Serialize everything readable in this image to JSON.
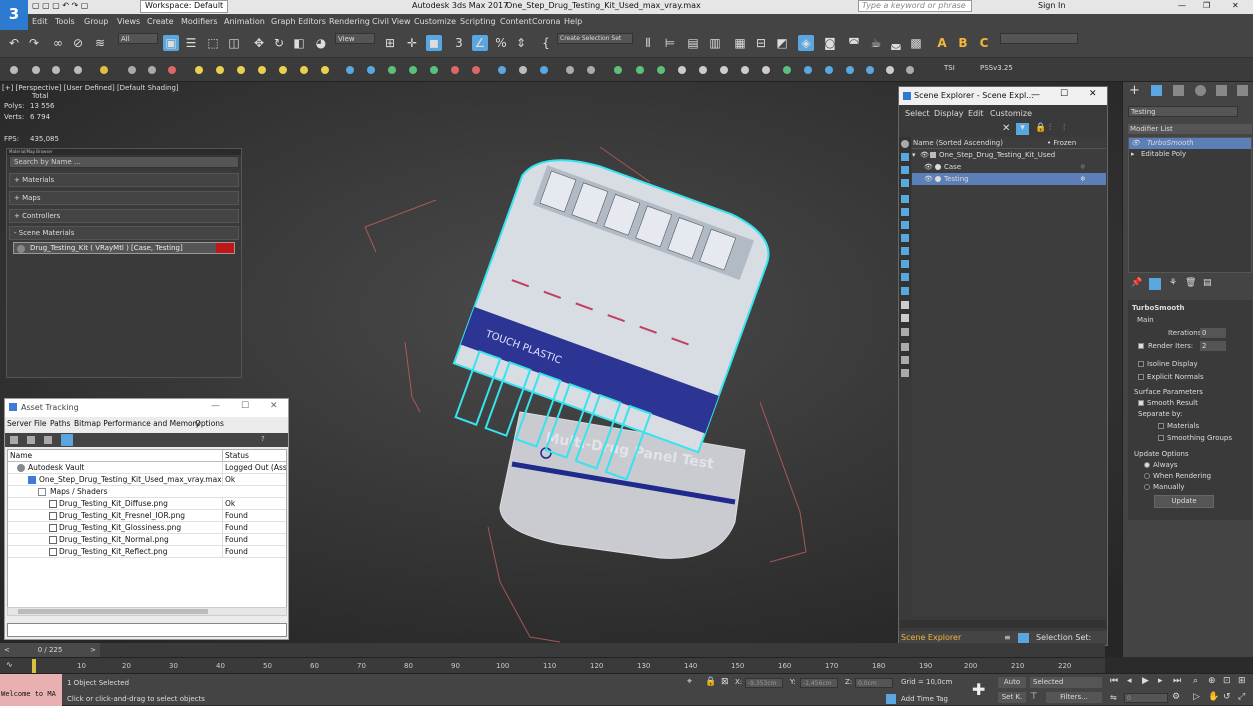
{
  "titlebar": {
    "workspace": "Workspace: Default",
    "app_title": "Autodesk 3ds Max 2017",
    "file_title": "One_Step_Drug_Testing_Kit_Used_max_vray.max",
    "search_placeholder": "Type a keyword or phrase",
    "sign_in": "Sign In"
  },
  "menu": [
    "Edit",
    "Tools",
    "Group",
    "Views",
    "Create",
    "Modifiers",
    "Animation",
    "Graph Editors",
    "Rendering",
    "Civil View",
    "Customize",
    "Scripting",
    "Content",
    "Corona",
    "Help"
  ],
  "toolbar": {
    "filter_all": "All",
    "view_dropdown": "View",
    "selection_set": "Create Selection Set",
    "tsi": "TSI",
    "pssv": "PSSv3.25"
  },
  "viewport": {
    "label": "[+] [Perspective] [User Defined] [Default Shading]",
    "total": "Total",
    "polys_label": "Polys:",
    "polys": "13 556",
    "verts_label": "Verts:",
    "verts": "6 794",
    "fps_label": "FPS:",
    "fps": "435,085",
    "product_text": "Multi-Drug Panel Test",
    "warning_text": "TOUCH PLASTIC"
  },
  "material_browser": {
    "title": "Material/Map Browser",
    "search_placeholder": "Search by Name ...",
    "sections": [
      "+ Materials",
      "+ Maps",
      "+ Controllers",
      "- Scene Materials"
    ],
    "scene_material": "Drug_Testing_Kit  ( VRayMtl )  [Case, Testing]"
  },
  "asset_tracking": {
    "title": "Asset Tracking",
    "menu": [
      "Server",
      "File",
      "Paths",
      "Bitmap Performance and Memory",
      "Options"
    ],
    "col_name": "Name",
    "col_status": "Status",
    "rows": [
      {
        "name": "Autodesk Vault",
        "status": "Logged Out (Asset",
        "indent": 0
      },
      {
        "name": "One_Step_Drug_Testing_Kit_Used_max_vray.max",
        "status": "Ok",
        "indent": 1
      },
      {
        "name": "Maps / Shaders",
        "status": "",
        "indent": 2
      },
      {
        "name": "Drug_Testing_Kit_Diffuse.png",
        "status": "Ok",
        "indent": 3
      },
      {
        "name": "Drug_Testing_Kit_Fresnel_IOR.png",
        "status": "Found",
        "indent": 3
      },
      {
        "name": "Drug_Testing_Kit_Glossiness.png",
        "status": "Found",
        "indent": 3
      },
      {
        "name": "Drug_Testing_Kit_Normal.png",
        "status": "Found",
        "indent": 3
      },
      {
        "name": "Drug_Testing_Kit_Reflect.png",
        "status": "Found",
        "indent": 3
      }
    ]
  },
  "scene_explorer": {
    "title": "Scene Explorer - Scene Expl...",
    "menu": [
      "Select",
      "Display",
      "Edit",
      "Customize"
    ],
    "col_name": "Name (Sorted Ascending)",
    "col_frozen": "• Frozen",
    "items": [
      {
        "name": "One_Step_Drug_Testing_Kit_Used",
        "indent": 0,
        "selected": false
      },
      {
        "name": "Case",
        "indent": 1,
        "selected": false
      },
      {
        "name": "Testing",
        "indent": 1,
        "selected": true
      }
    ],
    "footer_label": "Scene Explorer",
    "selection_set": "Selection Set:"
  },
  "command_panel": {
    "object_name": "Testing",
    "modifier_list": "Modifier List",
    "stack": [
      "TurboSmooth",
      "Editable Poly"
    ],
    "rollout_title": "TurboSmooth",
    "main_label": "Main",
    "iterations_label": "Iterations:",
    "iterations": "0",
    "render_iters_label": "Render Iters:",
    "render_iters": "2",
    "isoline": "Isoline Display",
    "explicit_normals": "Explicit Normals",
    "surface_params": "Surface Parameters",
    "smooth_result": "Smooth Result",
    "separate_by": "Separate by:",
    "materials": "Materials",
    "smoothing_groups": "Smoothing Groups",
    "update_options": "Update Options",
    "always": "Always",
    "when_rendering": "When Rendering",
    "manually": "Manually",
    "update_button": "Update"
  },
  "timeline": {
    "frame": "0 / 225",
    "ticks": [
      "0",
      "10",
      "20",
      "30",
      "40",
      "50",
      "60",
      "70",
      "80",
      "90",
      "100",
      "110",
      "120",
      "130",
      "140",
      "150",
      "160",
      "170",
      "180",
      "190",
      "200",
      "210",
      "220"
    ]
  },
  "status": {
    "maxscript": "Welcome to MA",
    "selected": "1 Object Selected",
    "prompt": "Click or click-and-drag to select objects",
    "x_label": "X:",
    "x_value": "-9,353cm",
    "y_label": "Y:",
    "y_value": "-1,456cm",
    "z_label": "Z:",
    "z_value": "0,0cm",
    "grid": "Grid = 10,0cm",
    "add_time_tag": "Add Time Tag",
    "auto": "Auto",
    "selected_dropdown": "Selected",
    "set_key": "Set K.",
    "filters": "Filters...",
    "frame_value": "0"
  }
}
